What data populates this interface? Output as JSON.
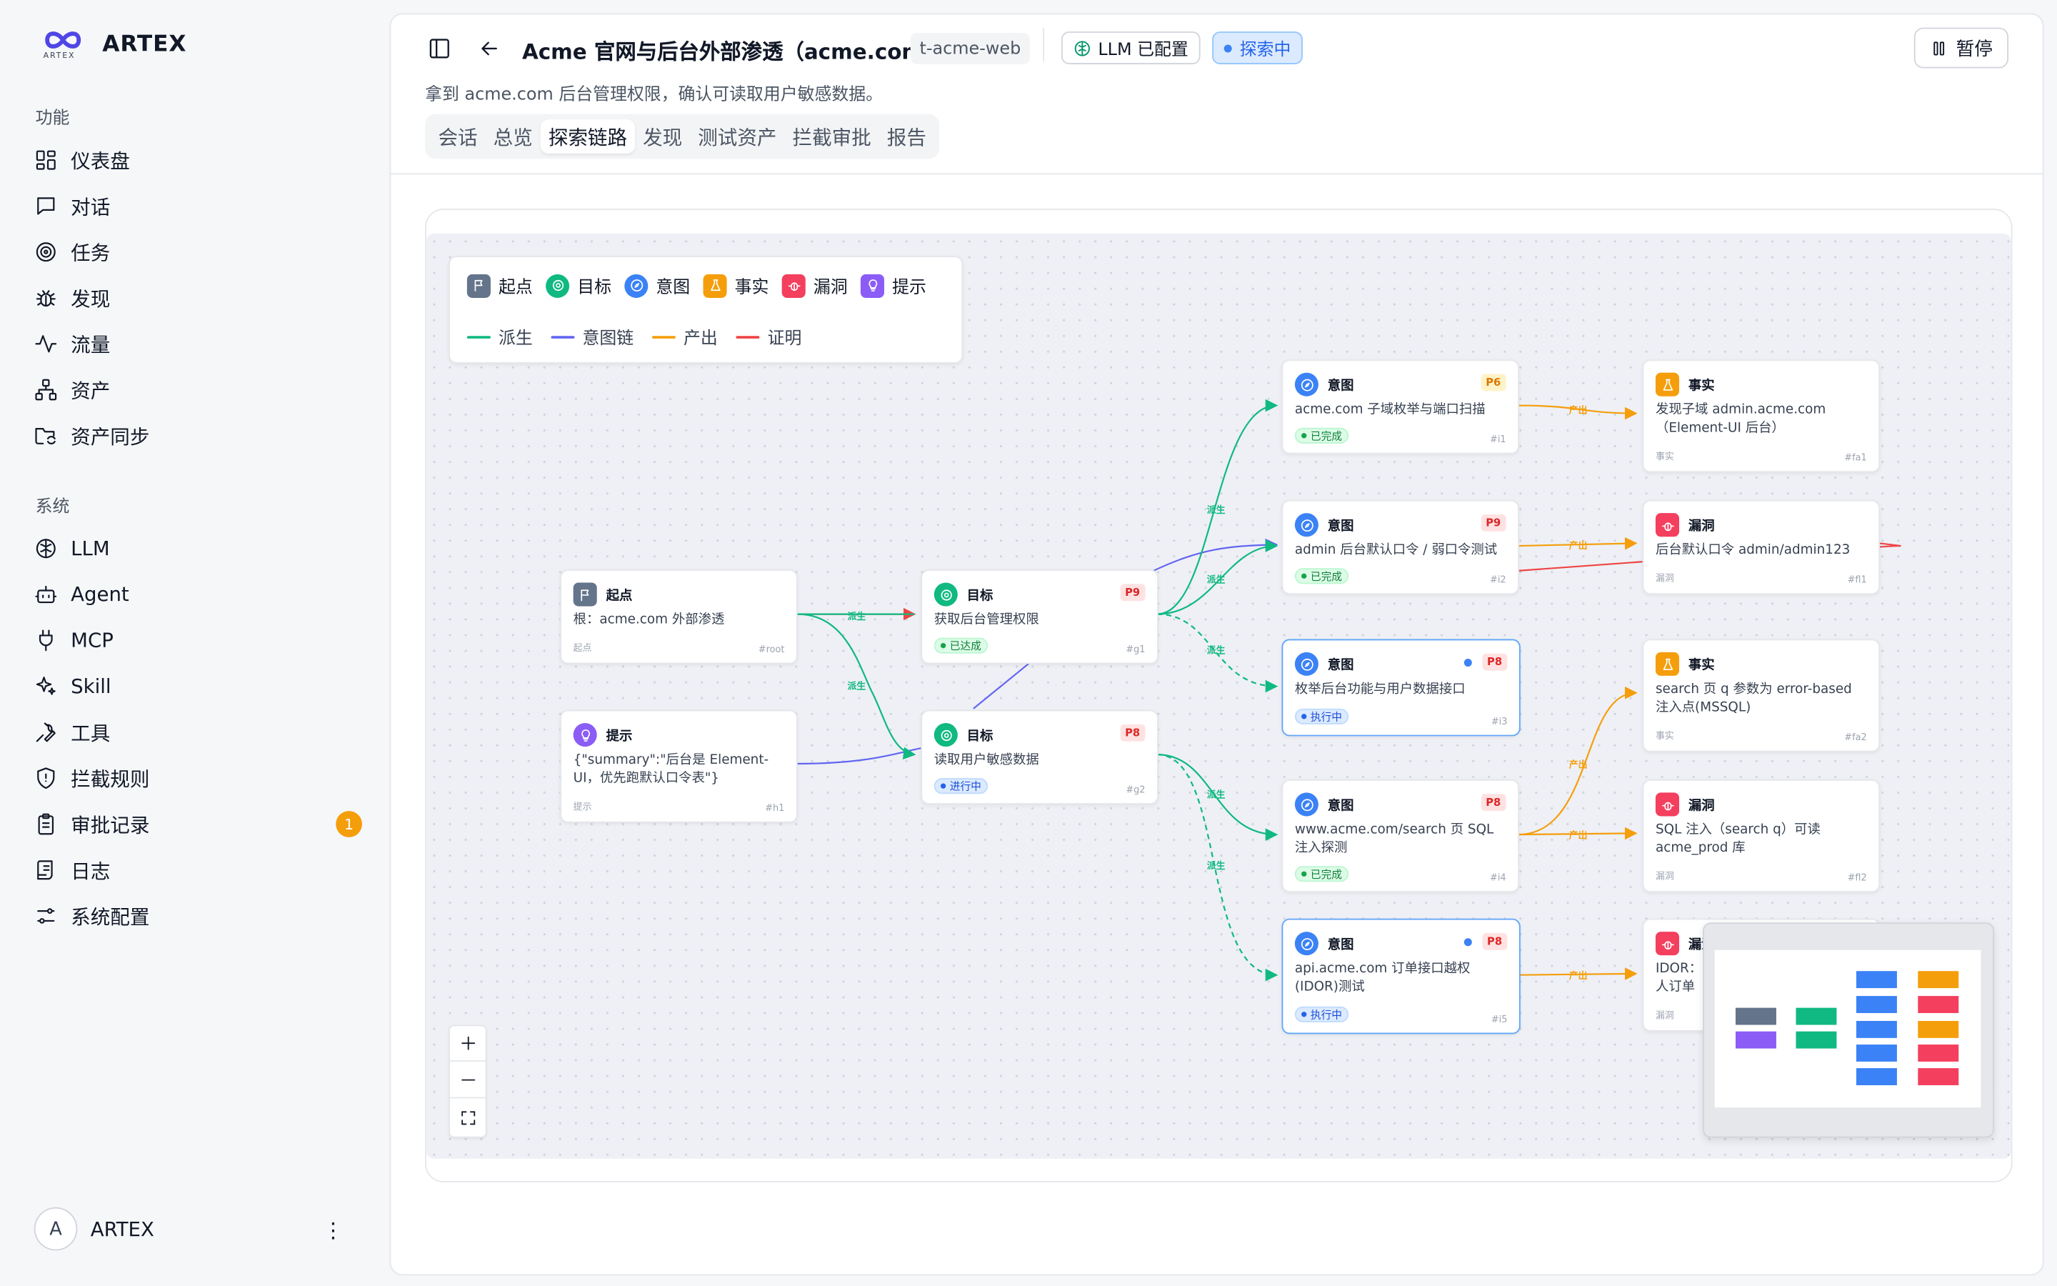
{
  "brand": {
    "name": "ARTEX",
    "logo_text": "ARTEX"
  },
  "sidebar": {
    "section_features": "功能",
    "section_system": "系统",
    "features": [
      {
        "label": "仪表盘",
        "icon": "dashboard-icon"
      },
      {
        "label": "对话",
        "icon": "chat-icon"
      },
      {
        "label": "任务",
        "icon": "target-icon"
      },
      {
        "label": "发现",
        "icon": "bug-icon"
      },
      {
        "label": "流量",
        "icon": "activity-icon"
      },
      {
        "label": "资产",
        "icon": "network-icon"
      },
      {
        "label": "资产同步",
        "icon": "folder-sync-icon"
      }
    ],
    "system": [
      {
        "label": "LLM",
        "icon": "brain-icon"
      },
      {
        "label": "Agent",
        "icon": "bot-icon"
      },
      {
        "label": "MCP",
        "icon": "plug-icon"
      },
      {
        "label": "Skill",
        "icon": "sparkles-icon"
      },
      {
        "label": "工具",
        "icon": "wrench-icon"
      },
      {
        "label": "拦截规则",
        "icon": "shield-icon"
      },
      {
        "label": "审批记录",
        "icon": "clipboard-icon",
        "badge": "1"
      },
      {
        "label": "日志",
        "icon": "log-icon"
      },
      {
        "label": "系统配置",
        "icon": "sliders-icon"
      }
    ],
    "user": {
      "initial": "A",
      "name": "ARTEX"
    }
  },
  "header": {
    "title": "Acme 官网与后台外部渗透（acme.com）",
    "task_id": "t-acme-web",
    "llm_tag": "LLM 已配置",
    "status_tag": "探索中",
    "pause_label": "暂停",
    "subtitle": "拿到 acme.com 后台管理权限，确认可读取用户敏感数据。"
  },
  "tabs": [
    "会话",
    "总览",
    "探索链路",
    "发现",
    "测试资产",
    "拦截审批",
    "报告"
  ],
  "active_tab": "探索链路",
  "legend": {
    "nodes": [
      {
        "label": "起点",
        "color": "#64748b"
      },
      {
        "label": "目标",
        "color": "#10b981"
      },
      {
        "label": "意图",
        "color": "#3b82f6"
      },
      {
        "label": "事实",
        "color": "#f59e0b"
      },
      {
        "label": "漏洞",
        "color": "#f43f5e"
      },
      {
        "label": "提示",
        "color": "#8b5cf6"
      }
    ],
    "edges": [
      {
        "label": "派生",
        "color": "#10b981"
      },
      {
        "label": "意图链",
        "color": "#6366f1"
      },
      {
        "label": "产出",
        "color": "#f59e0b"
      },
      {
        "label": "证明",
        "color": "#ef4444"
      }
    ]
  },
  "nodes": {
    "root": {
      "title": "起点",
      "body": "根：acme.com 外部渗透",
      "foot": "起点",
      "id": "#root"
    },
    "hint": {
      "title": "提示",
      "body": "{\"summary\":\"后台是 Element-UI，优先跑默认口令表\"}",
      "foot": "提示",
      "id": "#h1"
    },
    "g1": {
      "title": "目标",
      "priority": "P9",
      "body": "获取后台管理权限",
      "status": "已达成",
      "id": "#g1"
    },
    "g2": {
      "title": "目标",
      "priority": "P8",
      "body": "读取用户敏感数据",
      "status": "进行中",
      "id": "#g2"
    },
    "i1": {
      "title": "意图",
      "priority": "P6",
      "body": "acme.com 子域枚举与端口扫描",
      "status": "已完成",
      "id": "#i1"
    },
    "i2": {
      "title": "意图",
      "priority": "P9",
      "body": "admin 后台默认口令 / 弱口令测试",
      "status": "已完成",
      "id": "#i2"
    },
    "i3": {
      "title": "意图",
      "priority": "P8",
      "body": "枚举后台功能与用户数据接口",
      "status": "执行中",
      "id": "#i3"
    },
    "i4": {
      "title": "意图",
      "priority": "P8",
      "body": "www.acme.com/search 页 SQL 注入探测",
      "status": "已完成",
      "id": "#i4"
    },
    "i5": {
      "title": "意图",
      "priority": "P8",
      "body": "api.acme.com 订单接口越权(IDOR)测试",
      "status": "执行中",
      "id": "#i5"
    },
    "fa1": {
      "title": "事实",
      "body": "发现子域 admin.acme.com（Element-UI 后台）",
      "foot": "事实",
      "id": "#fa1"
    },
    "fl1": {
      "title": "漏洞",
      "body": "后台默认口令 admin/admin123",
      "foot": "漏洞",
      "id": "#fl1"
    },
    "fa2": {
      "title": "事实",
      "body": "search 页 q 参数为 error-based 注入点(MSSQL)",
      "foot": "事实",
      "id": "#fa2"
    },
    "fl2": {
      "title": "漏洞",
      "body": "SQL 注入（search q）可读 acme_prod 库",
      "foot": "漏洞",
      "id": "#fl2"
    },
    "fl3": {
      "title": "漏洞",
      "body": "IDOR：人订单",
      "foot": "漏洞",
      "id": ""
    }
  },
  "edge_labels": {
    "derive": "派生",
    "produce": "产出"
  },
  "colors": {
    "accent": "#3b82f6",
    "derive": "#10b981",
    "intent_chain": "#6366f1",
    "produce": "#f59e0b",
    "proof": "#ef4444"
  }
}
